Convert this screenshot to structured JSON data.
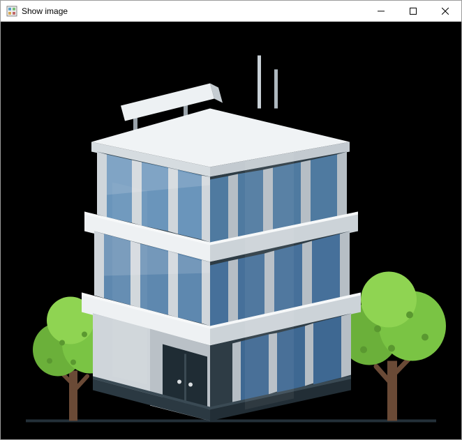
{
  "window": {
    "title": "Show image"
  },
  "content": {
    "description": "office-building-with-trees-illustration"
  }
}
